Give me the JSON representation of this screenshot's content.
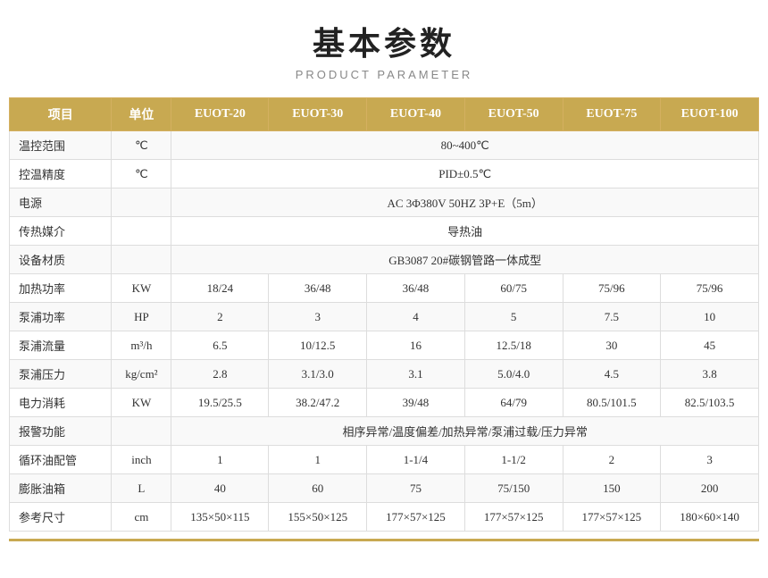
{
  "title": "基本参数",
  "subtitle": "PRODUCT PARAMETER",
  "table": {
    "headers": [
      "项目",
      "单位",
      "EUOT-20",
      "EUOT-30",
      "EUOT-40",
      "EUOT-50",
      "EUOT-75",
      "EUOT-100"
    ],
    "rows": [
      {
        "label": "温控范围",
        "unit": "℃",
        "span": true,
        "spanText": "80~400℃"
      },
      {
        "label": "控温精度",
        "unit": "℃",
        "span": true,
        "spanText": "PID±0.5℃"
      },
      {
        "label": "电源",
        "unit": "",
        "span": true,
        "spanText": "AC 3Φ380V 50HZ 3P+E（5m）"
      },
      {
        "label": "传热媒介",
        "unit": "",
        "span": true,
        "spanText": "导热油"
      },
      {
        "label": "设备材质",
        "unit": "",
        "span": true,
        "spanText": "GB3087   20#碳钢管路一体成型"
      },
      {
        "label": "加热功率",
        "unit": "KW",
        "span": false,
        "values": [
          "18/24",
          "36/48",
          "36/48",
          "60/75",
          "75/96",
          "75/96"
        ]
      },
      {
        "label": "泵浦功率",
        "unit": "HP",
        "span": false,
        "values": [
          "2",
          "3",
          "4",
          "5",
          "7.5",
          "10"
        ]
      },
      {
        "label": "泵浦流量",
        "unit": "m³/h",
        "span": false,
        "values": [
          "6.5",
          "10/12.5",
          "16",
          "12.5/18",
          "30",
          "45"
        ]
      },
      {
        "label": "泵浦压力",
        "unit": "kg/cm²",
        "span": false,
        "values": [
          "2.8",
          "3.1/3.0",
          "3.1",
          "5.0/4.0",
          "4.5",
          "3.8"
        ]
      },
      {
        "label": "电力消耗",
        "unit": "KW",
        "span": false,
        "values": [
          "19.5/25.5",
          "38.2/47.2",
          "39/48",
          "64/79",
          "80.5/101.5",
          "82.5/103.5"
        ]
      },
      {
        "label": "报警功能",
        "unit": "",
        "span": true,
        "spanText": "相序异常/温度偏差/加热异常/泵浦过载/压力异常"
      },
      {
        "label": "循环油配管",
        "unit": "inch",
        "span": false,
        "values": [
          "1",
          "1",
          "1-1/4",
          "1-1/2",
          "2",
          "3"
        ]
      },
      {
        "label": "膨胀油箱",
        "unit": "L",
        "span": false,
        "values": [
          "40",
          "60",
          "75",
          "75/150",
          "150",
          "200"
        ]
      },
      {
        "label": "参考尺寸",
        "unit": "cm",
        "span": false,
        "values": [
          "135×50×115",
          "155×50×125",
          "177×57×125",
          "177×57×125",
          "177×57×125",
          "180×60×140"
        ]
      }
    ]
  }
}
